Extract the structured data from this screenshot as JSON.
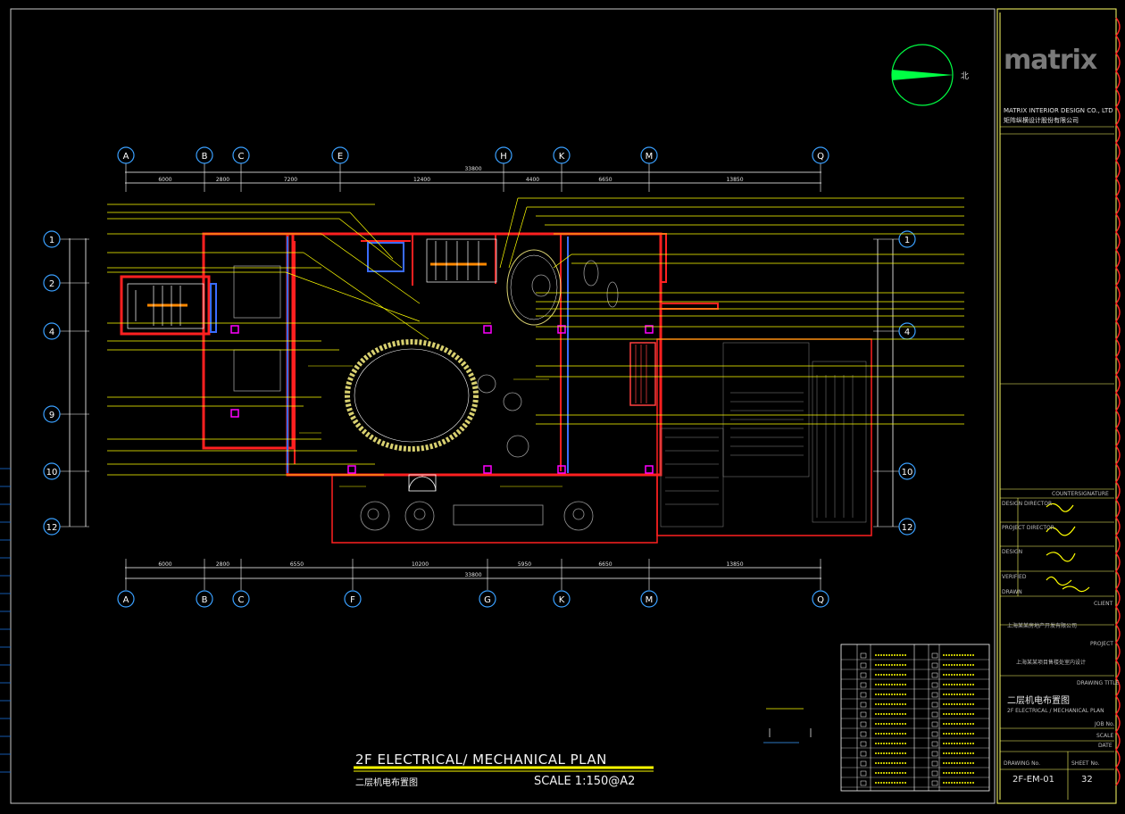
{
  "drawing": {
    "title_en": "2F ELECTRICAL/ MECHANICAL PLAN",
    "title_cn": "二层机电布置图",
    "scale_label": "SCALE  1:150@A2"
  },
  "north": {
    "label": "北"
  },
  "grid": {
    "top_letters": [
      "A",
      "B",
      "C",
      "E",
      "H",
      "K",
      "M",
      "Q"
    ],
    "bottom_letters": [
      "A",
      "B",
      "C",
      "F",
      "G",
      "K",
      "M",
      "Q"
    ],
    "left_numbers": [
      "1",
      "2",
      "4",
      "9",
      "10",
      "12"
    ],
    "right_numbers": [
      "1",
      "4",
      "10",
      "12"
    ],
    "top_dims": [
      "6000",
      "2800",
      "7200",
      "12400",
      "4400",
      "6650",
      "13850"
    ],
    "top_total": "33800",
    "bottom_dims": [
      "6000",
      "2800",
      "6550",
      "10200",
      "5950",
      "6650",
      "13850"
    ],
    "bottom_total": "33800"
  },
  "titleblock": {
    "brand": "matrix",
    "company_en": "MATRIX INTERIOR DESIGN CO., LTD",
    "company_cn": "矩阵纵横设计股份有限公司",
    "countersignature": "COUNTERSIGNATURE",
    "roles": [
      "DESIGN DIRECTOR",
      "PROJECT DIRECTOR",
      "DESIGN",
      "VERIFIED",
      "DRAWN"
    ],
    "client_label": "CLIENT",
    "client_value": "上海某某房地产开发有限公司",
    "project_label": "PROJECT",
    "project_value": "上海某某项目售楼处室内设计",
    "drawing_title_label": "DRAWING TITLE",
    "drawing_title_cn": "二层机电布置图",
    "drawing_title_en": "2F ELECTRICAL / MECHANICAL PLAN",
    "job_label": "JOB No.",
    "scale_label": "SCALE",
    "date_label": "DATE",
    "drawing_no_label": "DRAWING No.",
    "sheet_no_label": "SHEET No.",
    "drawing_no": "2F-EM-01",
    "sheet_no": "32"
  },
  "colors": {
    "background": "#000000",
    "wall": "#ff2020",
    "annotation": "#ffff00",
    "gridline": "#ffffff",
    "axis_bubble": "#3aa0ff",
    "north_arrow": "#00ff44",
    "magenta": "#ff00ff",
    "frame": "#ffff66"
  }
}
